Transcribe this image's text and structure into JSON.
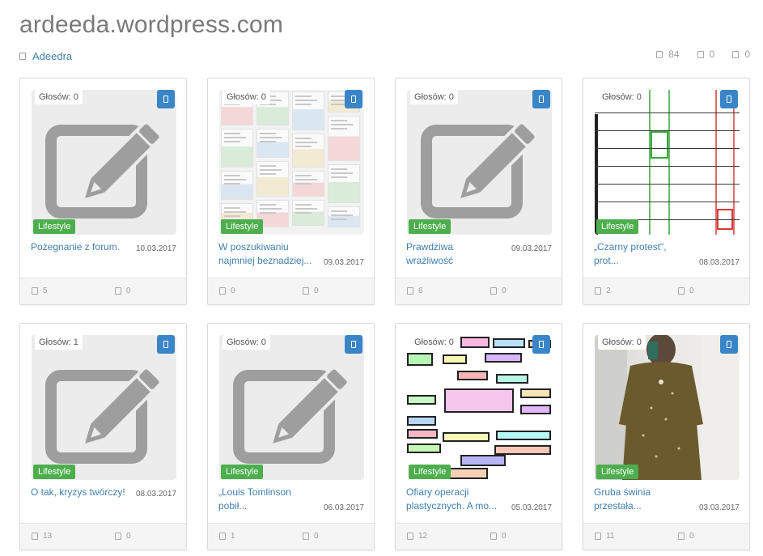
{
  "site": {
    "title": "ardeeda.wordpress.com",
    "author": "Adeedra",
    "stats": [
      "84",
      "0",
      "0"
    ]
  },
  "colors": {
    "link": "#3f7fb0",
    "category": "#4cae4c",
    "bookmark": "#3a85c8"
  },
  "icons": {
    "bookmark": "bookmark-icon",
    "comment": "comment-icon",
    "placeholder": "edit-pencil-icon"
  },
  "cards": [
    {
      "votes": "Głosów: 0",
      "category": "Lifestyle",
      "title": "Pożegnanie z forum.",
      "date": "10.03.2017",
      "stat1": "5",
      "stat2": "0",
      "thumb": "placeholder"
    },
    {
      "votes": "Głosów: 0",
      "category": "Lifestyle",
      "title": "W poszukiwaniu najmniej beznadziej...",
      "date": "09.03.2017",
      "stat1": "0",
      "stat2": "0",
      "thumb": "screens"
    },
    {
      "votes": "Głosów: 0",
      "category": "Lifestyle",
      "title": "Prawdziwa wrażliwość",
      "date": "09.03.2017",
      "stat1": "6",
      "stat2": "0",
      "thumb": "placeholder"
    },
    {
      "votes": "Głosów: 0",
      "category": "Lifestyle",
      "title": "„Czarny protest\", prot...",
      "date": "08.03.2017",
      "stat1": "2",
      "stat2": "0",
      "thumb": "table"
    },
    {
      "votes": "Głosów: 1",
      "category": "Lifestyle",
      "title": "O tak, kryzys twórczy!",
      "date": "08.03.2017",
      "stat1": "13",
      "stat2": "0",
      "thumb": "placeholder"
    },
    {
      "votes": "Głosów: 0",
      "category": "Lifestyle",
      "title": "„Louis Tomlinson pobił...",
      "date": "06.03.2017",
      "stat1": "1",
      "stat2": "0",
      "thumb": "placeholder"
    },
    {
      "votes": "Głosów: 0",
      "category": "Lifestyle",
      "title": "Ofiary operacji plastycznych. A mo...",
      "date": "05.03.2017",
      "stat1": "12",
      "stat2": "0",
      "thumb": "flow"
    },
    {
      "votes": "Głosów: 0",
      "category": "Lifestyle",
      "title": "Gruba świnia przestała...",
      "date": "03.03.2017",
      "stat1": "11",
      "stat2": "0",
      "thumb": "photo"
    }
  ]
}
